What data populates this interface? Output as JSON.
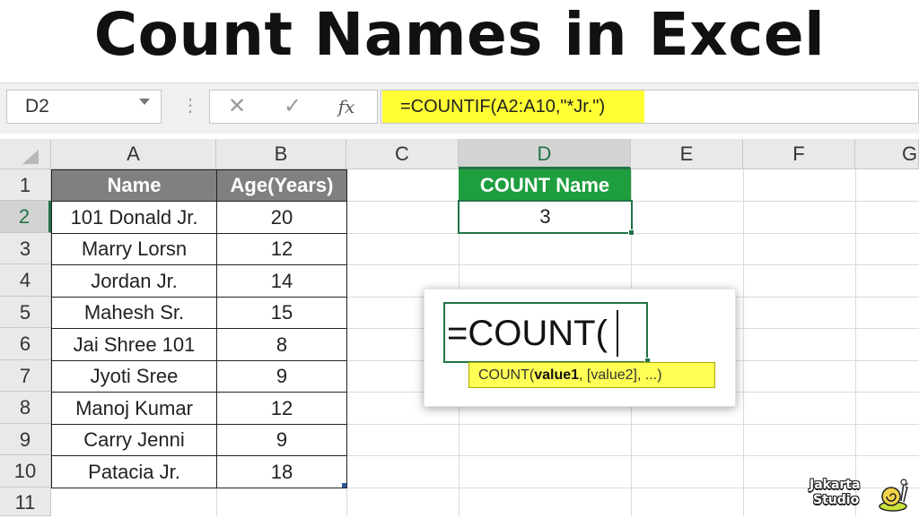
{
  "title": "Count Names in Excel",
  "formula_bar": {
    "name_box": "D2",
    "cancel_icon": "close-icon",
    "enter_icon": "check-icon",
    "function_label": "fx",
    "formula": "=COUNTIF(A2:A10,\"*Jr.\")",
    "highlight_color": "#ffff33"
  },
  "columns": [
    "A",
    "B",
    "C",
    "D",
    "E",
    "F",
    "G"
  ],
  "selected_column": "D",
  "rows": [
    "1",
    "2",
    "3",
    "4",
    "5",
    "6",
    "7",
    "8",
    "9",
    "10",
    "11"
  ],
  "selected_row": "2",
  "table": {
    "headers": [
      "Name",
      "Age(Years)"
    ],
    "rows": [
      [
        "101 Donald Jr.",
        "20"
      ],
      [
        "Marry Lorsn",
        "12"
      ],
      [
        "Jordan Jr.",
        "14"
      ],
      [
        "Mahesh Sr.",
        "15"
      ],
      [
        "Jai Shree 101",
        "8"
      ],
      [
        "Jyoti Sree",
        "9"
      ],
      [
        "Manoj Kumar",
        "12"
      ],
      [
        "Carry Jenni",
        "9"
      ],
      [
        "Patacia Jr.",
        "18"
      ]
    ]
  },
  "count_box": {
    "header": "COUNT Name",
    "value": "3",
    "header_color": "#1e9e3e"
  },
  "popup": {
    "typed_text": "=COUNT(",
    "tooltip_fn": "COUNT(",
    "tooltip_arg1": "value1",
    "tooltip_rest": ", [value2], ...)"
  },
  "logo": {
    "line1": "Jakarta",
    "line2": "Studio"
  },
  "colors": {
    "excel_green": "#217346",
    "header_gray": "#808080"
  }
}
